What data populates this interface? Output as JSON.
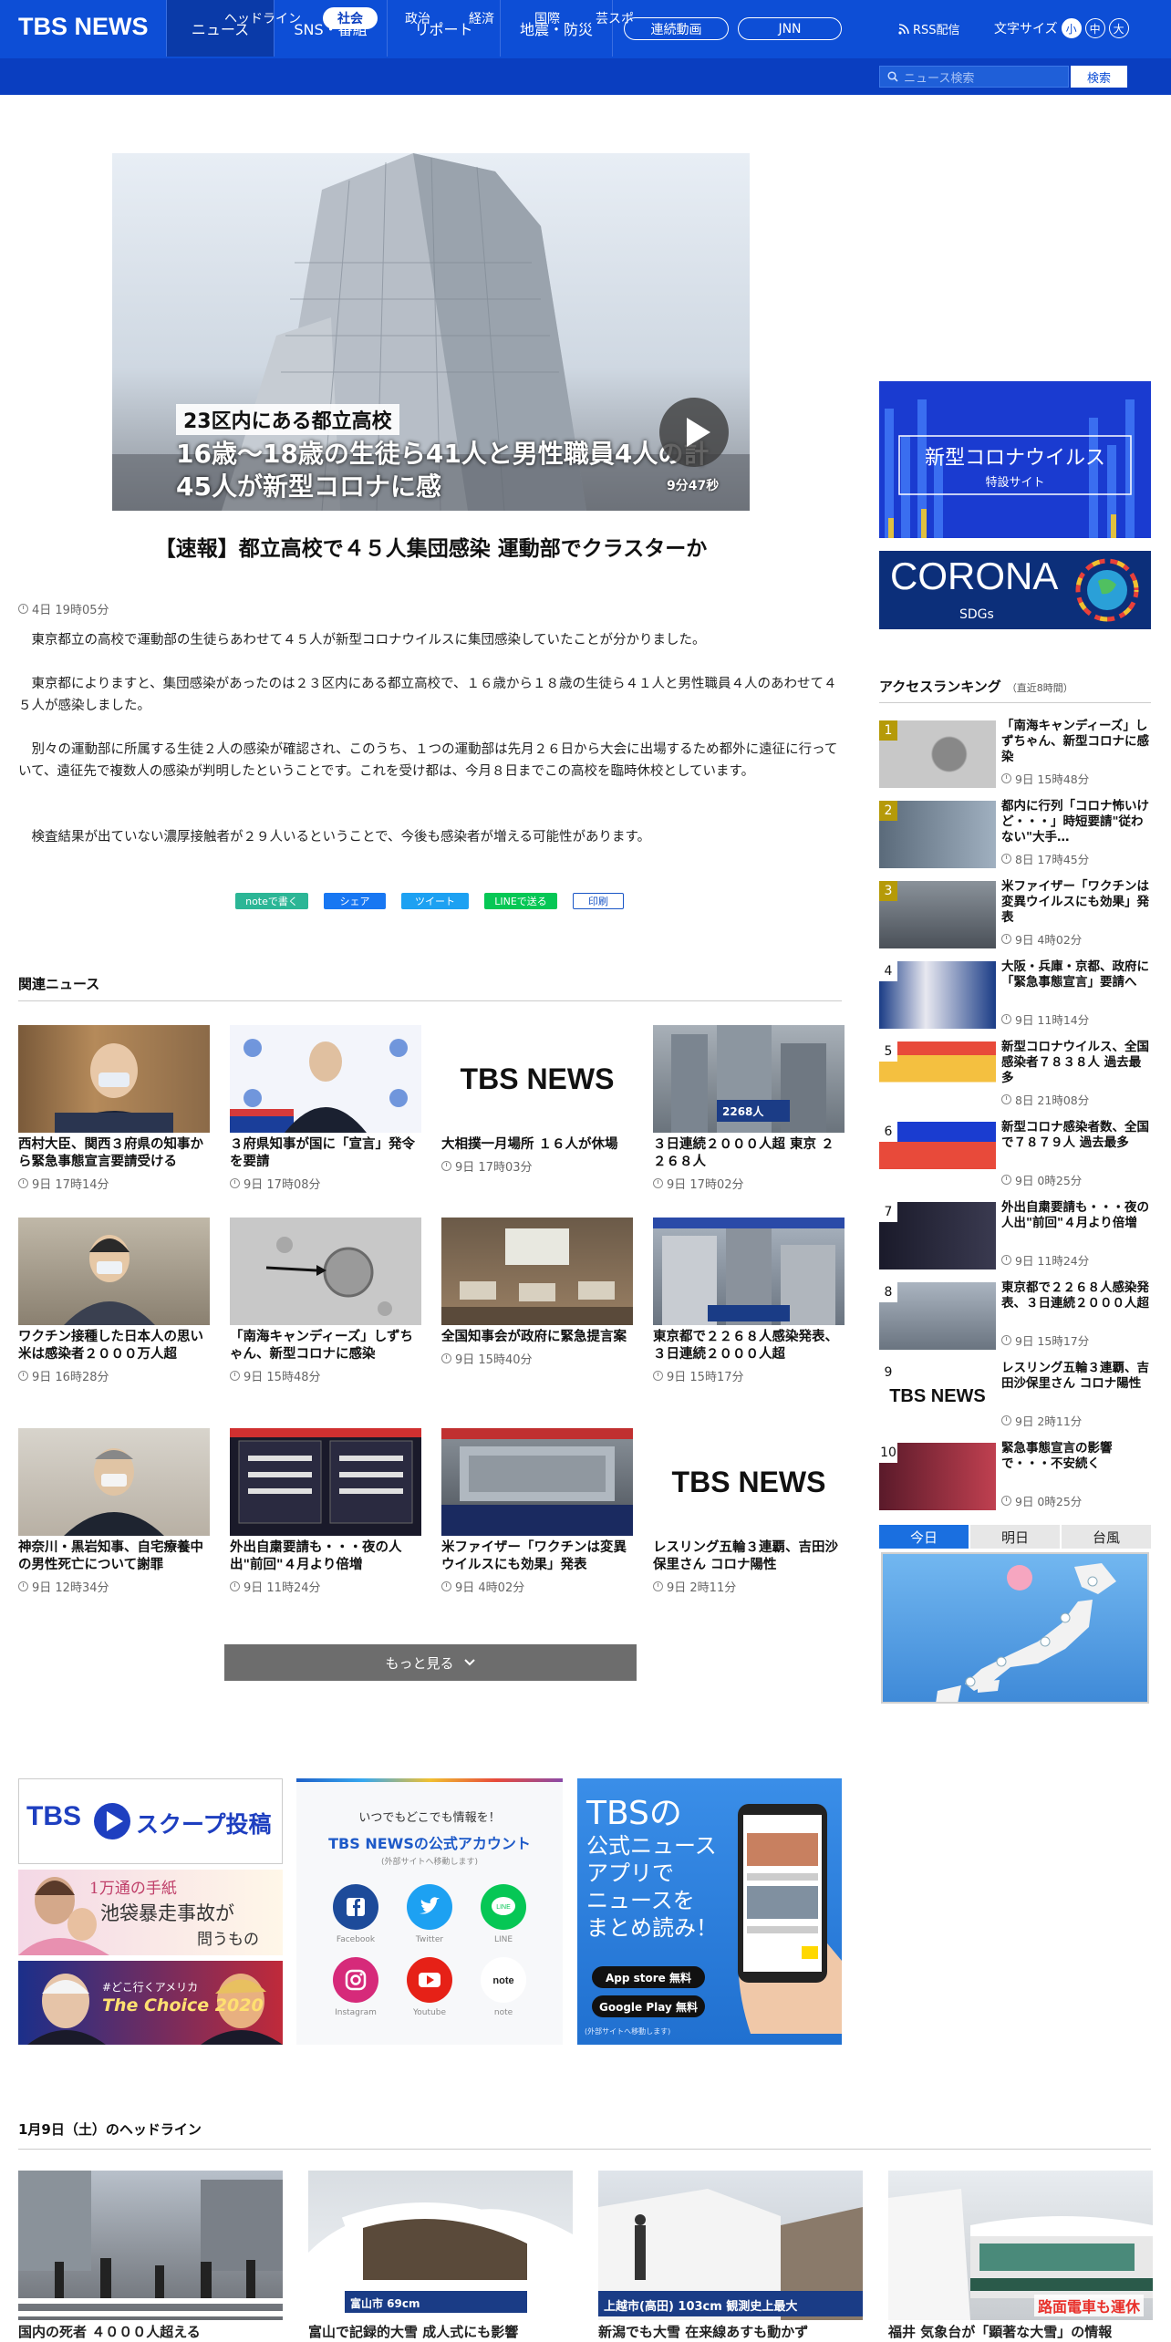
{
  "header": {
    "logo": "TBS NEWS",
    "nav": [
      {
        "label": "ニュース",
        "active": true
      },
      {
        "label": "SNS・番組"
      },
      {
        "label": "リポート"
      },
      {
        "label": "地震・防災"
      }
    ],
    "pills": [
      "連続動画",
      "JNN"
    ],
    "rss": "RSS配信",
    "font_size_label": "文字サイズ",
    "font_sizes": [
      "小",
      "中",
      "大"
    ],
    "subnav": [
      {
        "label": "ヘッドライン"
      },
      {
        "label": "社会",
        "active": true
      },
      {
        "label": "政治"
      },
      {
        "label": "経済"
      },
      {
        "label": "国際"
      },
      {
        "label": "芸スポ"
      }
    ],
    "search_placeholder": "ニュース検索",
    "search_button": "検索"
  },
  "article": {
    "video_caption_1": "23区内にある都立高校",
    "video_caption_2": "16歳～18歳の生徒ら41人と男性職員4人の計45人が新型コロナに感",
    "video_duration": "9分47秒",
    "title": "【速報】都立高校で４５人集団感染 運動部でクラスターか",
    "date": "4日 19時05分",
    "paragraphs": [
      "東京都立の高校で運動部の生徒らあわせて４５人が新型コロナウイルスに集団感染していたことが分かりました。",
      "東京都によりますと、集団感染があったのは２３区内にある都立高校で、１６歳から１８歳の生徒ら４１人と男性職員４人のあわせて４５人が感染しました。",
      "別々の運動部に所属する生徒２人の感染が確認され、このうち、１つの運動部は先月２６日から大会に出場するため都外に遠征に行っていて、遠征先で複数人の感染が判明したということです。これを受け都は、今月８日までこの高校を臨時休校としています。",
      "検査結果が出ていない濃厚接触者が２９人いるということで、今後も感染者が増える可能性があります。"
    ],
    "share": [
      {
        "label": "noteで書く",
        "color": "#2cb696"
      },
      {
        "label": "シェア",
        "color": "#1877f2"
      },
      {
        "label": "ツイート",
        "color": "#1da1f2"
      },
      {
        "label": "LINEで送る",
        "color": "#06c755"
      },
      {
        "label": "印刷",
        "color": "#ffffff"
      }
    ]
  },
  "related": {
    "heading": "関連ニュース",
    "items": [
      {
        "title": "西村大臣、関西３府県の知事から緊急事態宣言要請受ける",
        "date": "9日 17時14分"
      },
      {
        "title": "３府県知事が国に「宣言」発令を要請",
        "date": "9日 17時08分"
      },
      {
        "title": "大相撲一月場所 １６人が休場",
        "date": "9日 17時03分"
      },
      {
        "title": "３日連続２０００人超 東京 ２２６８人",
        "date": "9日 17時02分"
      },
      {
        "title": "ワクチン接種した日本人の思い米は感染者２０００万人超",
        "date": "9日 16時28分"
      },
      {
        "title": "「南海キャンディーズ」しずちゃん、新型コロナに感染",
        "date": "9日 15時48分"
      },
      {
        "title": "全国知事会が政府に緊急提言案",
        "date": "9日 15時40分"
      },
      {
        "title": "東京都で２２６８人感染発表、３日連続２０００人超",
        "date": "9日 15時17分"
      },
      {
        "title": "神奈川・黒岩知事、自宅療養中の男性死亡について謝罪",
        "date": "9日 12時34分"
      },
      {
        "title": "外出自粛要請も・・・夜の人出\"前回\"４月より倍増",
        "date": "9日 11時24分"
      },
      {
        "title": "米ファイザー「ワクチンは変異ウイルスにも効果」発表",
        "date": "9日 4時02分"
      },
      {
        "title": "レスリング五輪３連覇、吉田沙保里さん コロナ陽性",
        "date": "9日 2時11分"
      }
    ],
    "tbs_logo": "TBS NEWS",
    "thumb_text_3": "2268人",
    "more": "もっと見る"
  },
  "sidebar": {
    "corona_title": "新型コロナウイルス",
    "corona_sub": "特設サイト",
    "sdgs_title": "CORONA",
    "sdgs_sub": "SDGs",
    "ranking_title": "アクセスランキング",
    "ranking_sub": "（直近8時間）",
    "ranking": [
      {
        "rank": "1",
        "title": "「南海キャンディーズ」しずちゃん、新型コロナに感染",
        "date": "9日 15時48分"
      },
      {
        "rank": "2",
        "title": "都内に行列「コロナ怖いけど・・・」時短要請\"従わない\"大手…",
        "date": "8日 17時45分"
      },
      {
        "rank": "3",
        "title": "米ファイザー「ワクチンは変異ウイルスにも効果」発表",
        "date": "9日 4時02分"
      },
      {
        "rank": "4",
        "title": "大阪・兵庫・京都、政府に「緊急事態宣言」要請へ",
        "date": "9日 11時14分"
      },
      {
        "rank": "5",
        "title": "新型コロナウイルス、全国感染者７８３８人 過去最多",
        "date": "8日 21時08分"
      },
      {
        "rank": "6",
        "title": "新型コロナ感染者数、全国で７８７９人 過去最多",
        "date": "9日 0時25分"
      },
      {
        "rank": "7",
        "title": "外出自粛要請も・・・夜の人出\"前回\"４月より倍増",
        "date": "9日 11時24分"
      },
      {
        "rank": "8",
        "title": "東京都で２２６８人感染発表、３日連続２０００人超",
        "date": "9日 15時17分"
      },
      {
        "rank": "9",
        "title": "レスリング五輪３連覇、吉田沙保里さん コロナ陽性",
        "date": "9日 2時11分"
      },
      {
        "rank": "10",
        "title": "緊急事態宣言の影響で・・・不安続く",
        "date": "9日 0時25分"
      }
    ],
    "weather_tabs": [
      "今日",
      "明日",
      "台風"
    ]
  },
  "banners": {
    "scoop": "TBS ▶ スクープ投稿",
    "scoop_text": "TBS",
    "scoop_suffix": "スクープ投稿",
    "letters_top": "1万通の手紙",
    "letters_mid": "池袋暴走事故が",
    "letters_bot": "問うもの",
    "choice_pre": "#どこ行くアメリカ",
    "choice": "The Choice 2020",
    "official_line1": "いつでもどこでも情報を！",
    "official_line2": "TBS NEWSの公式アカウント",
    "official_line3": "(外部サイトへ移動します)",
    "sns": [
      "Facebook",
      "Twitter",
      "LINE",
      "Instagram",
      "Youtube",
      "note"
    ],
    "app_line1": "TBSの",
    "app_line2": "公式ニュース",
    "app_line3": "アプリで",
    "app_line4": "ニュースを",
    "app_line5": "まとめ読み！",
    "app_store": "App store 無料",
    "google_play": "Google Play 無料",
    "app_note": "(外部サイトへ移動します)"
  },
  "headlines": {
    "heading": "1月9日（土）のヘッドライン",
    "items": [
      "国内の死者 ４０００人超える",
      "富山で記録的大雪 成人式にも影響",
      "新潟でも大雪 在来線あすも動かず",
      "福井 気象台が「顕著な大雪」の情報"
    ],
    "thumb_text_2": "富山市 69cm",
    "thumb_text_3": "上越市(高田) 103cm 観測史上最大",
    "thumb_text_4": "路面電車も運休"
  }
}
